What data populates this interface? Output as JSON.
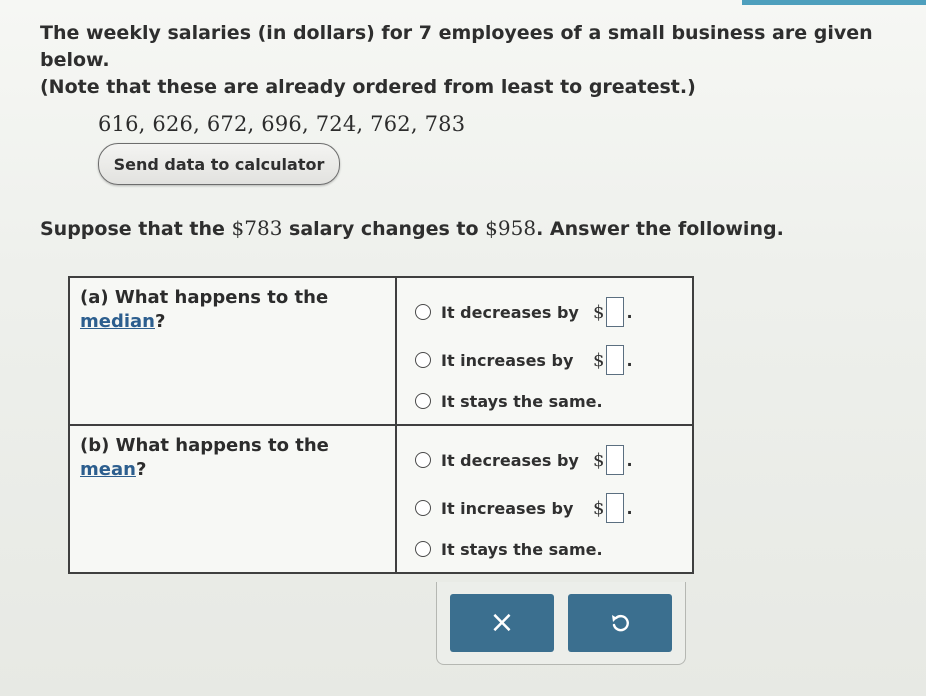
{
  "problem": {
    "line1": "The weekly salaries (in dollars) for 7 employees of a small business are given below.",
    "line2": "(Note that these are already ordered from least to greatest.)",
    "data": "616, 626, 672, 696, 724, 762, 783",
    "send_button": "Send data to calculator",
    "suppose_prefix": "Suppose that the ",
    "old_salary": "$783",
    "suppose_middle": " salary changes to ",
    "new_salary": "$958",
    "suppose_suffix": ". Answer the following."
  },
  "part_a": {
    "prefix": "(a)  What happens to the ",
    "term": "median",
    "suffix": "?",
    "options": [
      {
        "label": "It decreases by",
        "currency": "$",
        "period": "."
      },
      {
        "label": "It increases by",
        "currency": "$",
        "period": "."
      },
      {
        "label": "It stays the same."
      }
    ]
  },
  "part_b": {
    "prefix": "(b)  What happens to the ",
    "term": "mean",
    "suffix": "?",
    "options": [
      {
        "label": "It decreases by",
        "currency": "$",
        "period": "."
      },
      {
        "label": "It increases by",
        "currency": "$",
        "period": "."
      },
      {
        "label": "It stays the same."
      }
    ]
  },
  "actions": {
    "clear_icon": "x-icon",
    "clear_symbol": "×",
    "undo_icon": "undo-icon"
  }
}
